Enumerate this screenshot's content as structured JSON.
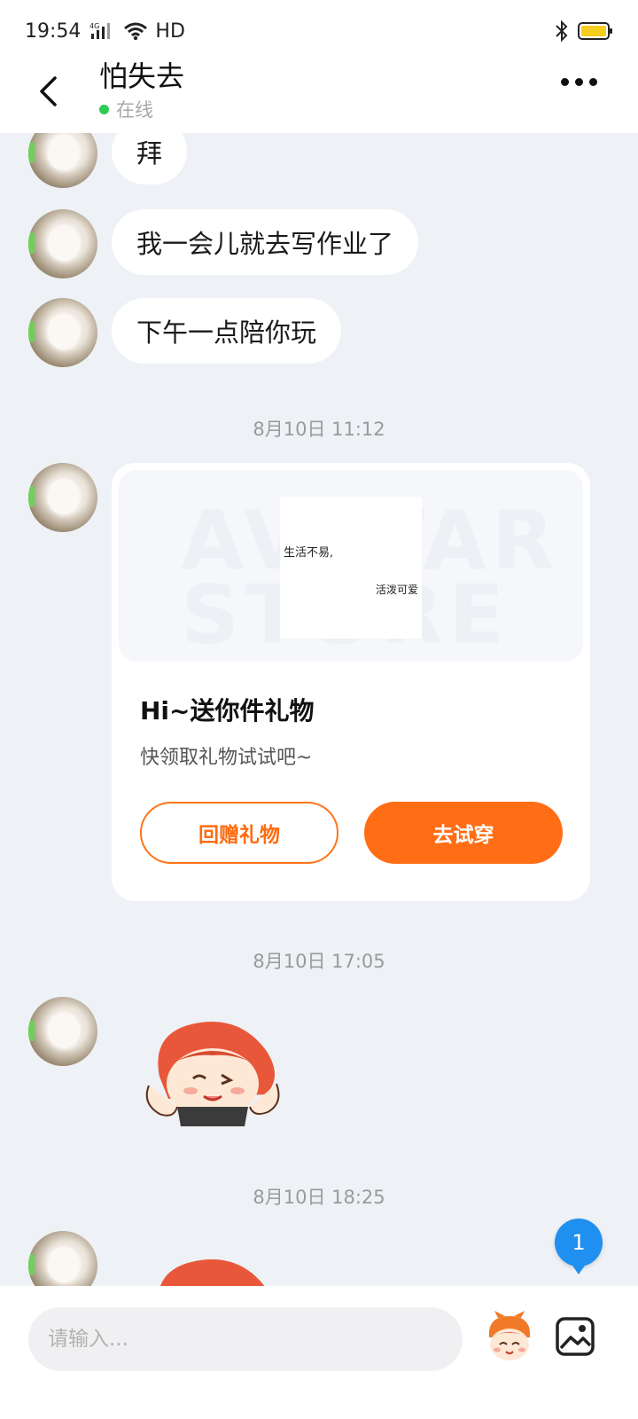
{
  "status_bar": {
    "time": "19:54",
    "network": "4G",
    "wifi_label": "HD"
  },
  "header": {
    "title": "怕失去",
    "status": "在线"
  },
  "messages": [
    {
      "type": "text",
      "text": "拜"
    },
    {
      "type": "text",
      "text": "我一会儿就去写作业了"
    },
    {
      "type": "text",
      "text": "下午一点陪你玩"
    }
  ],
  "timestamps": [
    "8月10日 11:12",
    "8月10日 17:05",
    "8月10日 18:25"
  ],
  "gift_card": {
    "watermark": "AVATAR STORE",
    "note_line1": "生活不易,",
    "note_line2": "活泼可爱",
    "title": "Hi~送你件礼物",
    "subtitle": "快领取礼物试试吧~",
    "return_gift_label": "回赠礼物",
    "try_on_label": "去试穿"
  },
  "unread_count": "1",
  "input_bar": {
    "placeholder": "请输入..."
  },
  "colors": {
    "accent": "#ff6e14",
    "badge": "#1f8ff0",
    "online": "#2ecc55",
    "background": "#eef1f5"
  }
}
